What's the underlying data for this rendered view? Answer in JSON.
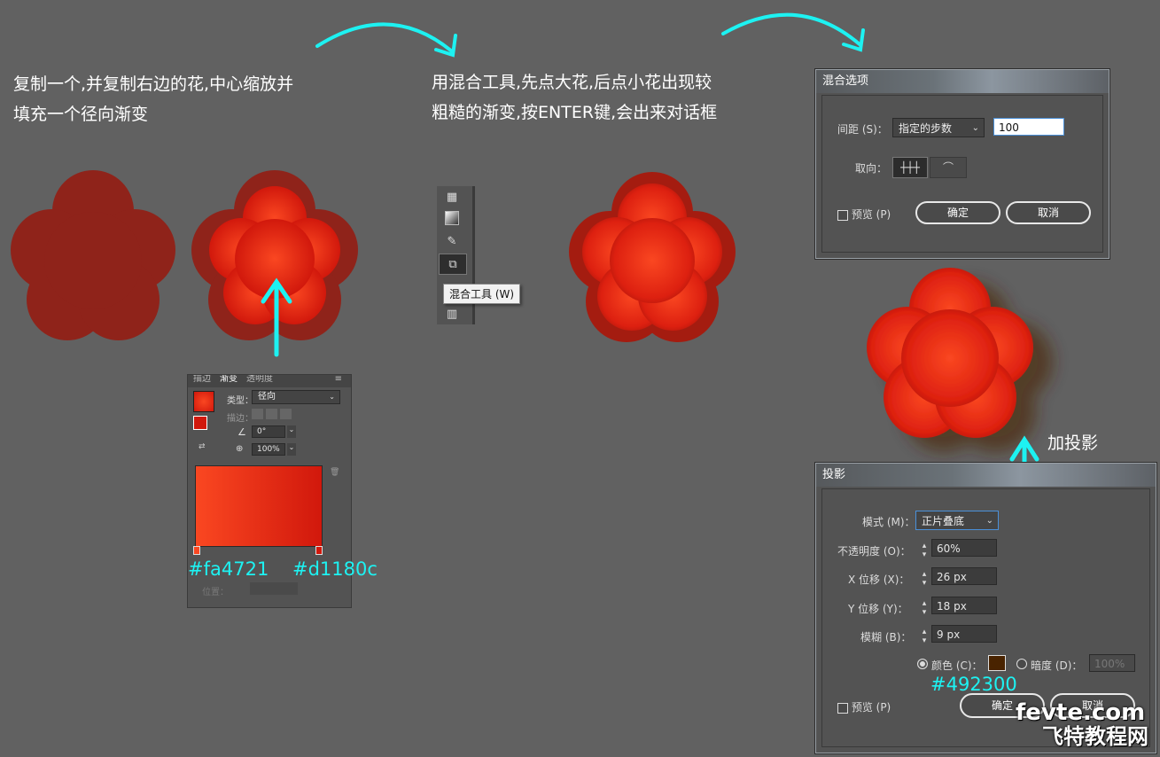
{
  "steps": {
    "step1_line1": "复制一个,并复制右边的花,中心缩放并",
    "step1_line2": "填充一个径向渐变",
    "step2_line1": "用混合工具,先点大花,后点小花出现较",
    "step2_line2": "粗糙的渐变,按ENTER键,会出来对话框",
    "step3": "加投影"
  },
  "gradient_panel": {
    "tabs": [
      "描边",
      "渐变",
      "透明度"
    ],
    "type_label": "类型：",
    "type_value": "径向",
    "stroke_label": "描边：",
    "angle_value": "0°",
    "aspect_value": "100%",
    "position_label": "位置：",
    "stop_left_color": "#fa4721",
    "stop_right_color": "#d1180c"
  },
  "color_labels": {
    "left": "#fa4721",
    "right": "#d1180c",
    "shadow": "#492300"
  },
  "toolbar": {
    "tooltip": "混合工具 (W)",
    "icons": [
      "mesh-icon",
      "gradient-icon",
      "eyedropper-icon",
      "blend-tool-icon",
      "graph-icon"
    ]
  },
  "blend_dialog": {
    "title": "混合选项",
    "spacing_label": "间距 (S)：",
    "spacing_value": "指定的步数",
    "steps_value": "100",
    "orientation_label": "取向：",
    "preview_label": "预览 (P)",
    "ok_label": "确定",
    "cancel_label": "取消"
  },
  "shadow_dialog": {
    "title": "投影",
    "mode_label": "模式 (M)：",
    "mode_value": "正片叠底",
    "opacity_label": "不透明度 (O)：",
    "opacity_value": "60%",
    "x_label": "X 位移 (X)：",
    "x_value": "26 px",
    "y_label": "Y 位移 (Y)：",
    "y_value": "18 px",
    "blur_label": "模糊 (B)：",
    "blur_value": "9 px",
    "color_label": "颜色 (C)：",
    "color_value": "#492300",
    "darkness_label": "暗度 (D)：",
    "darkness_value": "100%",
    "preview_label": "预览 (P)",
    "ok_label": "确定",
    "cancel_label": "取消"
  },
  "watermark": {
    "line1": "fevte.com",
    "line2": "飞特教程网"
  },
  "colors": {
    "accent_arrow": "#1df2f2",
    "flower_dark": "#8f231a",
    "gradient_center": "#fa4721",
    "gradient_edge": "#d1180c"
  }
}
